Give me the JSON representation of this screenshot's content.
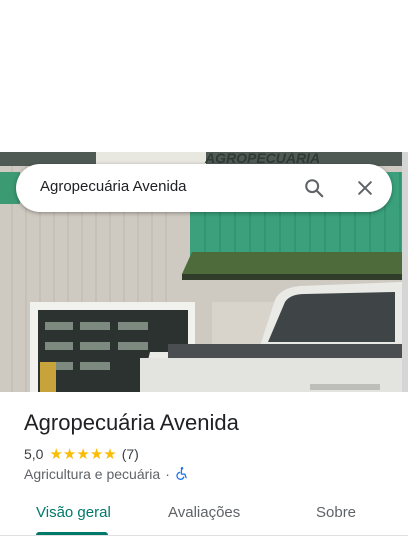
{
  "search": {
    "query": "Agropecuária Avenida",
    "icon_search": "search-icon",
    "icon_close": "close-icon"
  },
  "photo": {
    "sign_text": "AGROPECUÁRIA"
  },
  "place": {
    "name": "Agropecuária Avenida",
    "rating": "5,0",
    "stars": 5,
    "reviews": "(7)",
    "category": "Agricultura e pecuária",
    "separator": "·",
    "accessibility_icon": "wheelchair-icon"
  },
  "tabs": [
    {
      "label": "Visão geral",
      "active": true
    },
    {
      "label": "Avaliações",
      "active": false
    },
    {
      "label": "Sobre",
      "active": false
    }
  ],
  "colors": {
    "accent": "#00796b",
    "star": "#fbbc04",
    "accessible": "#1a73e8"
  }
}
